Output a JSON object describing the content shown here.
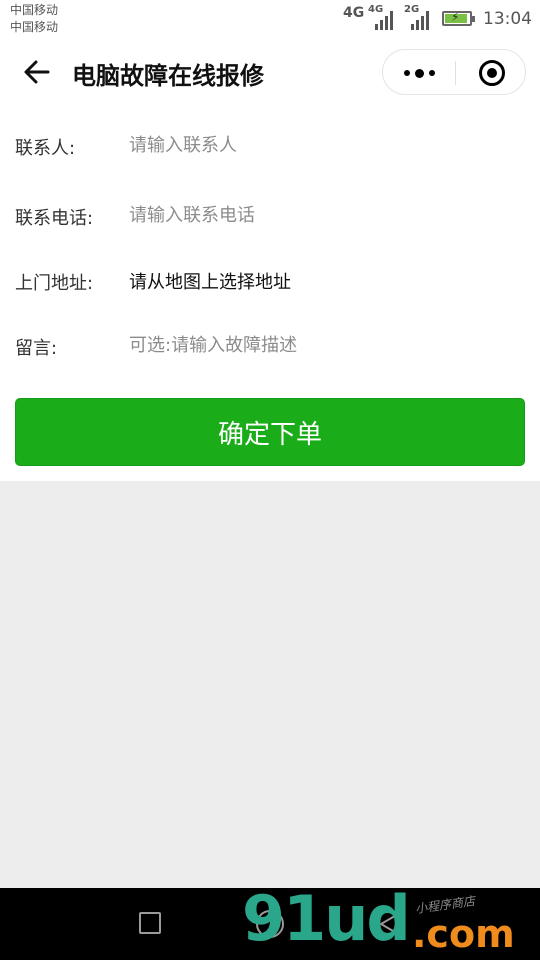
{
  "status_bar": {
    "carrier_1": "中国移动",
    "carrier_2": "中国移动",
    "sim1_network": "4G",
    "sim2_network_top": "4G",
    "sim2_network_bottom": "2G",
    "battery_icon": "battery-charging-icon",
    "time": "13:04"
  },
  "nav": {
    "back_icon": "arrow-left-icon",
    "title": "电脑故障在线报修",
    "more_icon": "more-dots-icon",
    "close_icon": "target-circle-icon"
  },
  "form": {
    "contact": {
      "label": "联系人:",
      "placeholder": "请输入联系人",
      "value": ""
    },
    "phone": {
      "label": "联系电话:",
      "placeholder": "请输入联系电话",
      "value": ""
    },
    "address": {
      "label": "上门地址:",
      "value": "请从地图上选择地址"
    },
    "message": {
      "label": "留言:",
      "placeholder": "可选:请输入故障描述",
      "value": ""
    },
    "submit_label": "确定下单"
  },
  "system_nav": {
    "recents_icon": "square-icon",
    "home_icon": "circle-icon",
    "back_icon": "triangle-back-icon"
  },
  "watermark": {
    "logo": "91ud",
    "domain": ".com",
    "tagline": "小程序商店"
  },
  "colors": {
    "primary_green": "#1aad19",
    "page_background": "#ededed",
    "placeholder_gray": "#8c8c8c"
  }
}
